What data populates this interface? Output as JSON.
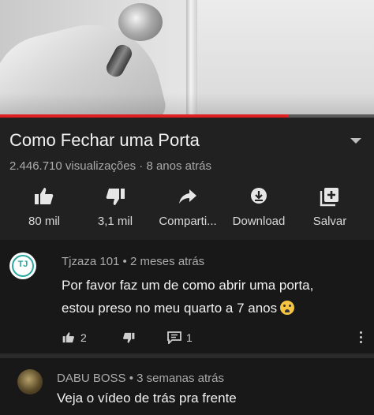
{
  "video": {
    "progress_fraction": 0.77,
    "progress_color": "#e02020"
  },
  "info": {
    "title": "Como Fechar uma Porta",
    "meta": "2.446.710 visualizações · 8 anos atrás"
  },
  "actions": [
    {
      "icon": "thumbs-up-icon",
      "label": "80 mil"
    },
    {
      "icon": "thumbs-down-icon",
      "label": "3,1 mil"
    },
    {
      "icon": "share-icon",
      "label": "Comparti..."
    },
    {
      "icon": "download-icon",
      "label": "Download"
    },
    {
      "icon": "add-to-playlist-icon",
      "label": "Salvar"
    }
  ],
  "comments": [
    {
      "avatar_text": "TJ",
      "header": "Tjzaza 101 • 2 meses atrás",
      "line1": "Por favor faz um de como abrir uma porta,",
      "line2": "estou preso no meu quarto a 7 anos",
      "emoji": "crying-face-icon",
      "likes": "2",
      "replies": "1"
    },
    {
      "header": "DABU BOSS • 3 semanas atrás",
      "text": "Veja o vídeo de trás pra frente"
    }
  ]
}
